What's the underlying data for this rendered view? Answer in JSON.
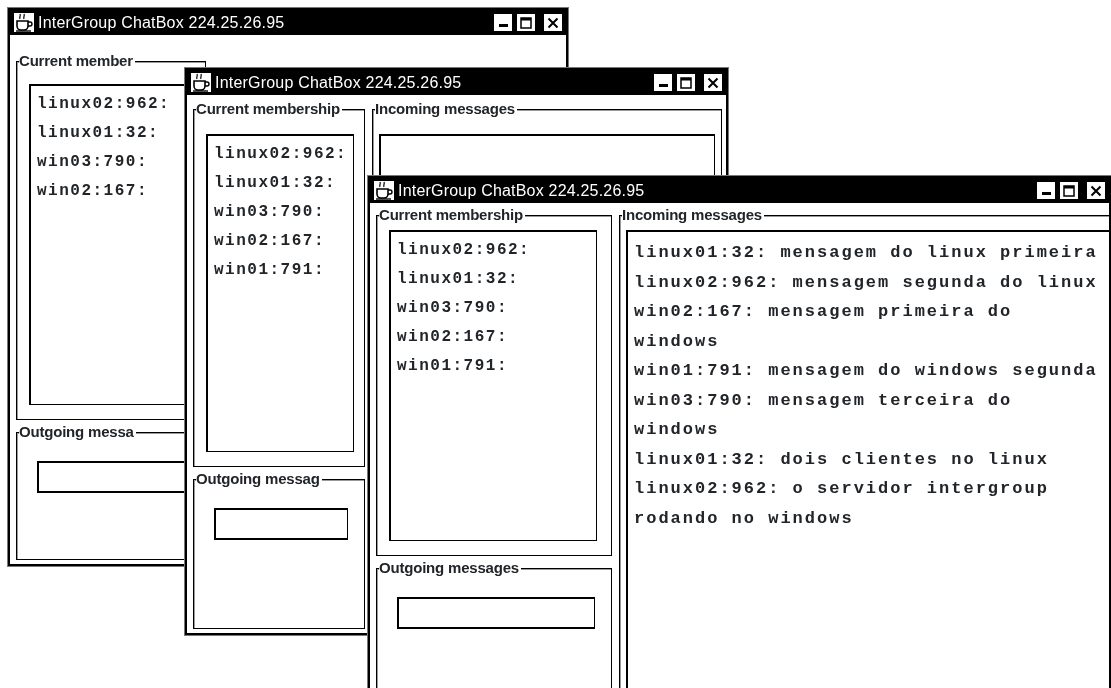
{
  "windows": [
    {
      "title": "InterGroup ChatBox 224.25.26.95",
      "membership_label": "Current member",
      "members": [
        "linux02:962:",
        "linux01:32:",
        "win03:790:",
        "win02:167:"
      ],
      "outgoing_label": "Outgoing messa"
    },
    {
      "title": "InterGroup ChatBox 224.25.26.95",
      "membership_label": "Current membership",
      "incoming_label": "Incoming messages",
      "members": [
        "linux02:962:",
        "linux01:32:",
        "win03:790:",
        "win02:167:",
        "win01:791:"
      ],
      "outgoing_label": "Outgoing messag"
    },
    {
      "title": "InterGroup ChatBox 224.25.26.95",
      "membership_label": "Current membership",
      "incoming_label": "Incoming messages",
      "members": [
        "linux02:962:",
        "linux01:32:",
        "win03:790:",
        "win02:167:",
        "win01:791:"
      ],
      "outgoing_label": "Outgoing messages",
      "messages": [
        "linux01:32: mensagem do linux primeira",
        "linux02:962: mensagem segunda do linux",
        "win02:167: mensagem primeira do windows",
        "win01:791: mensagem do windows segunda",
        "win03:790: mensagem terceira do windows",
        "linux01:32: dois clientes no linux",
        "linux02:962: o servidor intergroup rodando no windows"
      ]
    }
  ]
}
